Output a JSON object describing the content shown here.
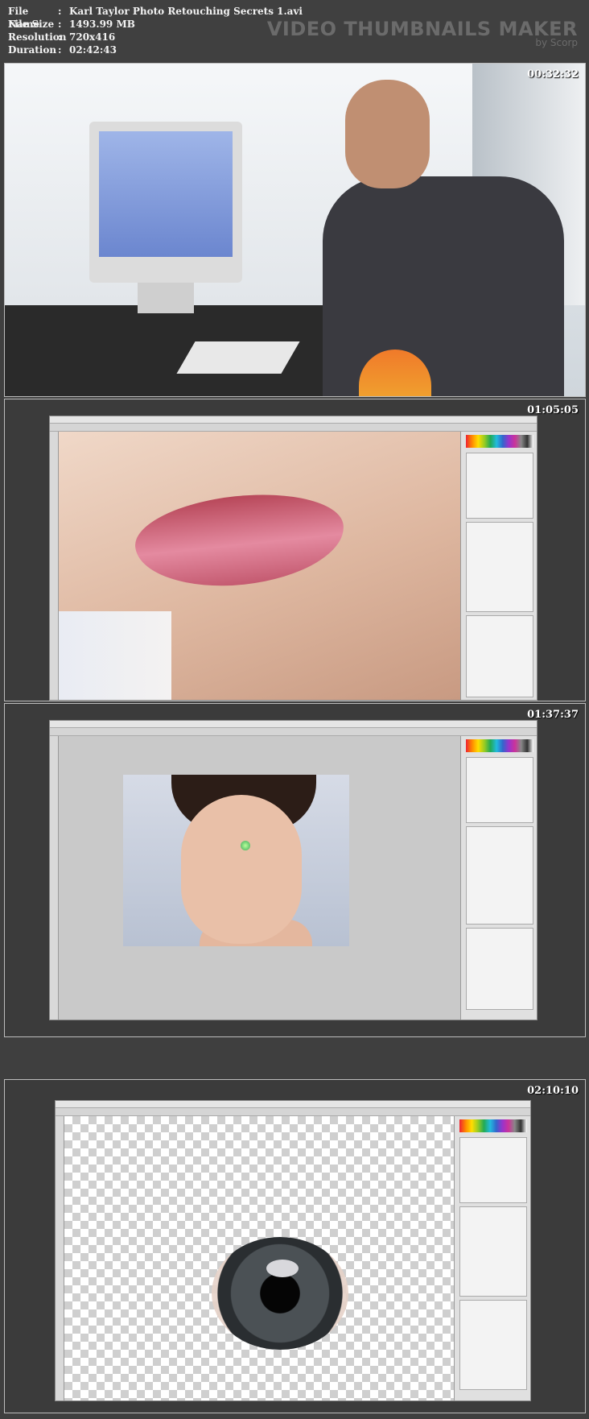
{
  "header": {
    "file_name_label": "File Name",
    "file_name_value": "Karl Taylor Photo Retouching Secrets 1.avi",
    "file_size_label": "File Size",
    "file_size_value": "1493.99 MB",
    "resolution_label": "Resolution",
    "resolution_value": "720x416",
    "duration_label": "Duration",
    "duration_value": "02:42:43",
    "separator": ":",
    "brand_title": "VIDEO THUMBNAILS MAKER",
    "brand_by": "by Scorp"
  },
  "thumbnails": [
    {
      "timestamp": "00:32:32"
    },
    {
      "timestamp": "01:05:05"
    },
    {
      "timestamp": "01:37:37"
    },
    {
      "timestamp": "02:10:10"
    }
  ]
}
